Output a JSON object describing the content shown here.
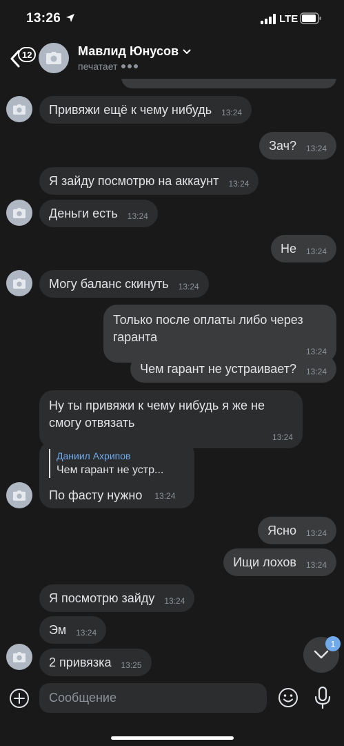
{
  "status_bar": {
    "time": "13:26",
    "carrier": "LTE"
  },
  "header": {
    "back_badge": "12",
    "contact_name": "Мавлид Юнусов",
    "status": "печатает"
  },
  "messages": [
    {
      "side": "in",
      "text": "Привяжи ещё к чему нибудь",
      "time": "13:24"
    },
    {
      "side": "out",
      "text": "Зач?",
      "time": "13:24"
    },
    {
      "side": "in",
      "text": "Я зайду посмотрю на аккаунт",
      "time": "13:24"
    },
    {
      "side": "in",
      "text": "Деньги есть",
      "time": "13:24"
    },
    {
      "side": "out",
      "text": "Не",
      "time": "13:24"
    },
    {
      "side": "in",
      "text": "Могу баланс скинуть",
      "time": "13:24"
    },
    {
      "side": "out",
      "text": "Только после оплаты либо через гаранта",
      "time": "13:24"
    },
    {
      "side": "out",
      "text": "Чем гарант не устраивает?",
      "time": "13:24"
    },
    {
      "side": "in",
      "text": "Ну ты привяжи к чему нибудь я же не смогу отвязать",
      "time": "13:24"
    },
    {
      "side": "in",
      "reply_author": "Даниил Ахрипов",
      "reply_text": "Чем гарант не устр...",
      "text": "По фасту нужно",
      "time": "13:24"
    },
    {
      "side": "out",
      "text": "Ясно",
      "time": "13:24"
    },
    {
      "side": "out",
      "text": "Ищи лохов",
      "time": "13:24"
    },
    {
      "side": "in",
      "text": "Я посмотрю зайду",
      "time": "13:24"
    },
    {
      "side": "in",
      "text": "Эм",
      "time": "13:24"
    },
    {
      "side": "in",
      "text": "2 привязка",
      "time": "13:25"
    }
  ],
  "scroll_down_badge": "1",
  "composer": {
    "placeholder": "Сообщение"
  },
  "colors": {
    "background": "#19191a",
    "incoming_bubble": "#2c2d2e",
    "outgoing_bubble": "#3a3b3c",
    "accent": "#71aaeb",
    "secondary_text": "#8d939b"
  }
}
